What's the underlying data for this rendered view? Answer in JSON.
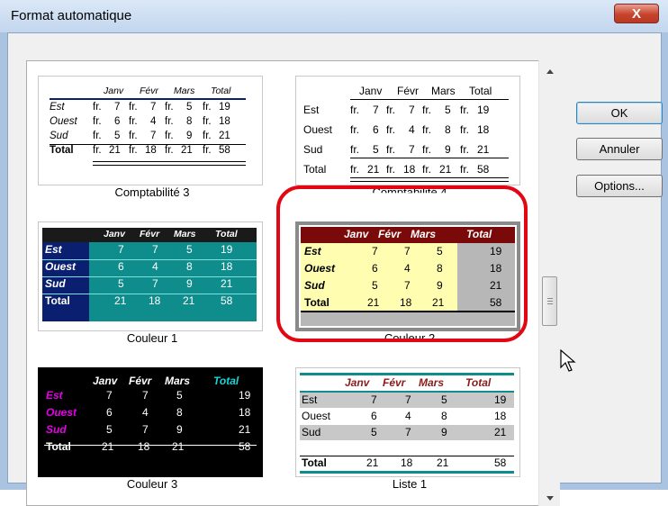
{
  "window": {
    "title": "Format automatique",
    "close_label": "X"
  },
  "buttons": {
    "ok": "OK",
    "cancel": "Annuler",
    "options": "Options..."
  },
  "table": {
    "headers": [
      "Janv",
      "Févr",
      "Mars",
      "Total"
    ],
    "rows": [
      {
        "name": "Est",
        "values": [
          "7",
          "7",
          "5",
          "19"
        ]
      },
      {
        "name": "Ouest",
        "values": [
          "6",
          "4",
          "8",
          "18"
        ]
      },
      {
        "name": "Sud",
        "values": [
          "5",
          "7",
          "9",
          "21"
        ]
      },
      {
        "name": "Total",
        "values": [
          "21",
          "18",
          "21",
          "58"
        ]
      }
    ],
    "currency": "fr."
  },
  "formats": [
    {
      "key": "comptabilite3",
      "label": "Comptabilité 3"
    },
    {
      "key": "comptabilite4",
      "label": "Comptabilité 4"
    },
    {
      "key": "couleur1",
      "label": "Couleur 1"
    },
    {
      "key": "couleur2",
      "label": "Couleur 2",
      "selected": true
    },
    {
      "key": "couleur3",
      "label": "Couleur 3"
    },
    {
      "key": "liste1",
      "label": "Liste 1"
    }
  ],
  "colors": {
    "accent_selection": "#e30613",
    "teal": "#0f8c8c",
    "navy": "#0a1f6f",
    "maroon": "#7a0a0a",
    "yellow": "#fffdb0"
  }
}
